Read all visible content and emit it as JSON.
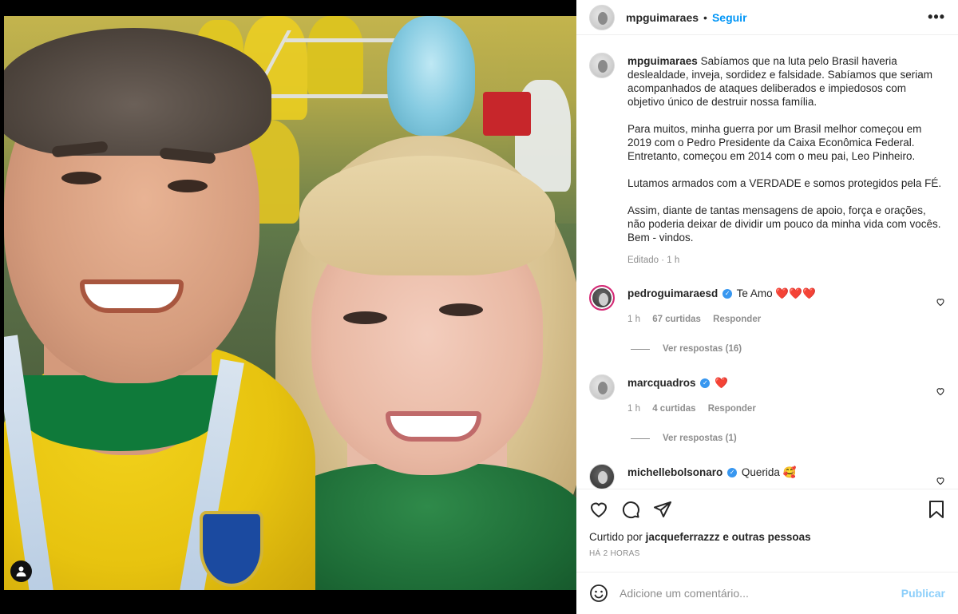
{
  "post": {
    "username": "mpguimaraes",
    "separator": "•",
    "follow_label": "Seguir",
    "more_label": "•••"
  },
  "caption": {
    "username": "mpguimaraes",
    "first_line": "Sabíamos que na luta pelo Brasil haveria deslealdade, inveja, sordidez e falsidade. Sabíamos que seriam acompanhados de ataques deliberados e impiedosos com objetivo único de destruir nossa família.",
    "p2": "Para muitos, minha guerra por um Brasil melhor começou em 2019 com o Pedro Presidente da Caixa Econômica Federal. Entretanto, começou em 2014 com o meu pai, Leo Pinheiro.",
    "p3": "Lutamos armados com a VERDADE e somos protegidos pela FÉ.",
    "p4": "Assim, diante de tantas mensagens de apoio, força e orações, não poderia deixar de dividir um pouco da minha vida com vocês. Bem - vindos.",
    "edited": "Editado · 1 h"
  },
  "comments": [
    {
      "username": "pedroguimaraesd",
      "verified": true,
      "text": "Te Amo ❤️❤️❤️",
      "time": "1 h",
      "likes": "67 curtidas",
      "reply": "Responder",
      "view_replies": "Ver respostas (16)"
    },
    {
      "username": "marcquadros",
      "verified": true,
      "text": "❤️",
      "time": "1 h",
      "likes": "4 curtidas",
      "reply": "Responder",
      "view_replies": "Ver respostas (1)"
    },
    {
      "username": "michellebolsonaro",
      "verified": true,
      "text": "Querida 🥰"
    }
  ],
  "actions": {
    "liked_by_prefix": "Curtido por",
    "liked_by_user": "jacqueferrazzz",
    "liked_by_suffix": "e outras pessoas",
    "time_ago": "HÁ 2 HORAS"
  },
  "add_comment": {
    "placeholder": "Adicione um comentário...",
    "publish_label": "Publicar"
  },
  "icons": {
    "photo_user_tag": "user-tag-icon",
    "like": "heart-icon",
    "comment": "comment-icon",
    "share": "paper-plane-icon",
    "save": "bookmark-icon",
    "emoji": "smiley-icon",
    "verified": "verified-badge-icon"
  },
  "colors": {
    "link_blue": "#0095f6",
    "verified_blue": "#3897f0",
    "meta_gray": "#8e8e8e",
    "text": "#262626"
  }
}
